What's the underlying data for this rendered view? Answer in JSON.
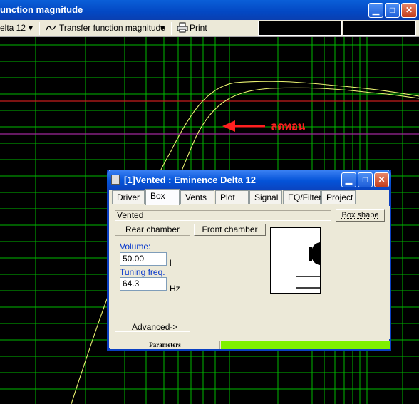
{
  "main_window": {
    "title": "unction magnitude"
  },
  "toolbar": {
    "driver_select": "elta 12",
    "dropdown_arrow": "▾",
    "view_select": "Transfer function magnitude",
    "print_label": "Print"
  },
  "annotation": {
    "text": "ลดทอน",
    "color": "#ff2020"
  },
  "dialog": {
    "title": "[1]Vented : Eminence  Delta 12",
    "tabs": [
      "Driver",
      "Box",
      "Vents",
      "Plot",
      "Signal",
      "EQ/Filter",
      "Project"
    ],
    "active_tab": "Box",
    "box_type": "Vented",
    "box_shape_button": "Box shape",
    "rear_chamber_button": "Rear chamber",
    "front_chamber_button": "Front chamber",
    "volume_label": "Volume:",
    "volume_value": "50.00",
    "volume_unit": "l",
    "tuning_label": "Tuning freq.",
    "tuning_value": "64.3",
    "tuning_unit": "Hz",
    "advanced_button": "Advanced->",
    "status_label": "Parameters",
    "status_fill_color": "#7ff000"
  },
  "colors": {
    "grid": "#00b800",
    "curve": "#e8f070",
    "red_line": "#c81e1e",
    "magenta_line": "#a0289b",
    "titlebar": "#0a4fd0"
  },
  "icons": [
    "chevron-down-icon",
    "wave-icon",
    "printer-icon",
    "minimize-icon",
    "maximize-icon",
    "close-icon",
    "window-system-icon",
    "arrow-left-icon"
  ]
}
